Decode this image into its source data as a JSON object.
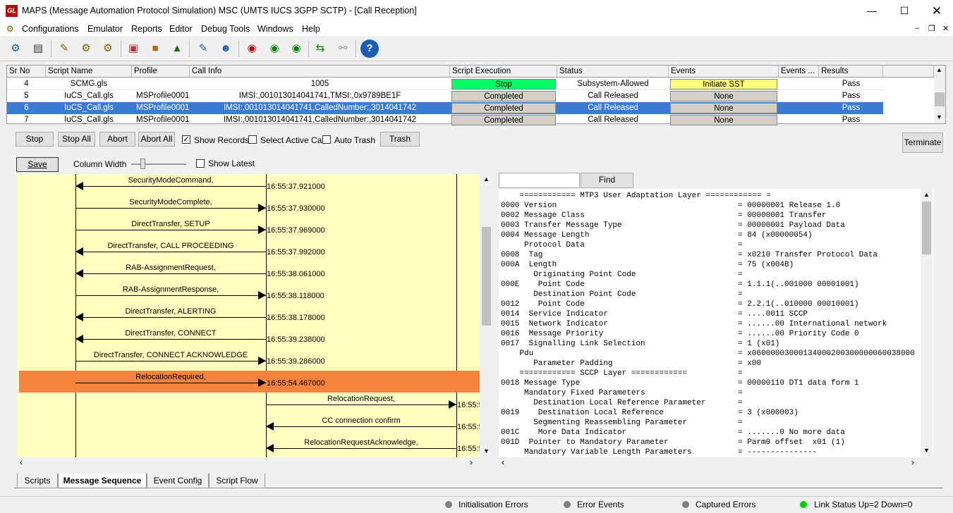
{
  "window": {
    "title": "MAPS (Message Automation Protocol Simulation) MSC (UMTS IUCS 3GPP SCTP) - [Call Reception]",
    "app_icon": "GL"
  },
  "menu": [
    "Configurations",
    "Emulator",
    "Reports",
    "Editor",
    "Debug Tools",
    "Windows",
    "Help"
  ],
  "grid": {
    "headers": [
      "Sr No",
      "Script Name",
      "Profile",
      "Call Info",
      "Script Execution",
      "Status",
      "Events",
      "Events ...",
      "Results"
    ],
    "rows": [
      {
        "sr": "4",
        "script": "SCMG.gls",
        "profile": "",
        "info": "1005",
        "exec": "Stop",
        "status": "Subsystem-Allowed",
        "events": "Initiate SST",
        "events2": "",
        "result": "Pass",
        "exec_color": "#00ff66",
        "events_color": "#ffff80",
        "selected": false
      },
      {
        "sr": "5",
        "script": "IuCS_Call.gls",
        "profile": "MSProfile0001",
        "info": "IMSI:,001013014041741,TMSI:,0x9789BE1F",
        "exec": "Completed",
        "status": "Call Released",
        "events": "None",
        "events2": "",
        "result": "Pass",
        "exec_color": "#d4d0c8",
        "events_color": "#d4d0c8",
        "selected": false
      },
      {
        "sr": "6",
        "script": "IuCS_Call.gls",
        "profile": "MSProfile0001",
        "info": "IMSI:,001013014041741,CalledNumber:,3014041742",
        "exec": "Completed",
        "status": "Call Released",
        "events": "None",
        "events2": "",
        "result": "Pass",
        "exec_color": "#d4d0c8",
        "events_color": "#d4d0c8",
        "selected": true
      },
      {
        "sr": "7",
        "script": "IuCS_Call.gls",
        "profile": "MSProfile0001",
        "info": "IMSI:,001013014041741,CalledNumber:,3014041742",
        "exec": "Completed",
        "status": "Call Released",
        "events": "None",
        "events2": "",
        "result": "Pass",
        "exec_color": "#d4d0c8",
        "events_color": "#d4d0c8",
        "selected": false
      }
    ]
  },
  "controls": {
    "stop": "Stop",
    "stop_all": "Stop All",
    "abort": "Abort",
    "abort_all": "Abort All",
    "show_records": "Show Records",
    "select_active": "Select Active Call",
    "auto_trash": "Auto Trash",
    "trash": "Trash",
    "terminate": "Terminate",
    "save": "Save",
    "column_width": "Column Width",
    "show_latest": "Show Latest",
    "find": "Find",
    "find_value": ""
  },
  "sequence": [
    {
      "label": "SecurityModeCommand,",
      "time": "16:55:37.921000",
      "dir": "left",
      "lane": 0,
      "highlight": false
    },
    {
      "label": "SecurityModeComplete,",
      "time": "16:55:37.930000",
      "dir": "right",
      "lane": 0,
      "highlight": false
    },
    {
      "label": "DirectTransfer, SETUP",
      "time": "16:55:37.969000",
      "dir": "right",
      "lane": 0,
      "highlight": false
    },
    {
      "label": "DirectTransfer, CALL PROCEEDING",
      "time": "16:55:37.992000",
      "dir": "left",
      "lane": 0,
      "highlight": false
    },
    {
      "label": "RAB-AssignmentRequest,",
      "time": "16:55:38.061000",
      "dir": "left",
      "lane": 0,
      "highlight": false
    },
    {
      "label": "RAB-AssignmentResponse,",
      "time": "16:55:38.118000",
      "dir": "right",
      "lane": 0,
      "highlight": false
    },
    {
      "label": "DirectTransfer, ALERTING",
      "time": "16:55:38.178000",
      "dir": "left",
      "lane": 0,
      "highlight": false
    },
    {
      "label": "DirectTransfer, CONNECT",
      "time": "16:55:39.238000",
      "dir": "left",
      "lane": 0,
      "highlight": false
    },
    {
      "label": "DirectTransfer, CONNECT ACKNOWLEDGE",
      "time": "16:55:39.286000",
      "dir": "right",
      "lane": 0,
      "highlight": false
    },
    {
      "label": "RelocationRequired,",
      "time": "16:55:54.467000",
      "dir": "right",
      "lane": 0,
      "highlight": true
    },
    {
      "label": "RelocationRequest,",
      "time": "16:55:5",
      "dir": "right",
      "lane": 1,
      "highlight": false
    },
    {
      "label": "CC connection confirm",
      "time": "16:55:5",
      "dir": "left",
      "lane": 1,
      "highlight": false
    },
    {
      "label": "RelocationRequestAcknowledge,",
      "time": "16:55:5",
      "dir": "left",
      "lane": 1,
      "highlight": false
    }
  ],
  "decode": [
    [
      "    ============ MTP3 User Adaptation Layer ============ =",
      ""
    ],
    [
      "0000 Version",
      "= 00000001 Release 1.0"
    ],
    [
      "0002 Message Class",
      "= 00000001 Transfer"
    ],
    [
      "0003 Transfer Message Type",
      "= 00000001 Payload Data"
    ],
    [
      "0004 Message Length",
      "= 84 (x00000054)"
    ],
    [
      "     Protocol Data",
      "="
    ],
    [
      "0008  Tag",
      "= x0210 Transfer Protocol Data"
    ],
    [
      "000A  Length",
      "= 75 (x004B)"
    ],
    [
      "       Originating Point Code",
      "="
    ],
    [
      "000E    Point Code",
      "= 1.1.1(..001000 00001001)"
    ],
    [
      "       Destination Point Code",
      "="
    ],
    [
      "0012    Point Code",
      "= 2.2.1(..010000 00010001)"
    ],
    [
      "0014  Service Indicator",
      "= ....0011 SCCP"
    ],
    [
      "0015  Network Indicator",
      "= ......00 International network"
    ],
    [
      "0016  Message Priority",
      "= ......00 Priority Code 0"
    ],
    [
      "0017  Signalling Link Selection",
      "= 1 (x01)"
    ],
    [
      "    Pdu",
      "= x06000003000134000200300000060038000"
    ],
    [
      "       Parameter Padding",
      "= x00"
    ],
    [
      "    ============ SCCP Layer ============",
      "="
    ],
    [
      "0018 Message Type",
      "= 00000110 DT1 data form 1"
    ],
    [
      "     Mandatory Fixed Parameters",
      "="
    ],
    [
      "       Destination Local Reference Parameter",
      "="
    ],
    [
      "0019    Destination Local Reference",
      "= 3 (x000003)"
    ],
    [
      "       Segmenting Reassembling Parameter",
      "="
    ],
    [
      "001C    More Data Indicator",
      "= .......0 No more data"
    ],
    [
      "001D  Pointer to Mandatory Parameter",
      "= Parm0 offset  x01 (1)"
    ],
    [
      "     Mandatory Variable Length Parameters",
      "= ---------------"
    ]
  ],
  "tabs": [
    "Scripts",
    "Message Sequence",
    "Event Config",
    "Script Flow"
  ],
  "status": {
    "init": "Initialisation Errors",
    "events": "Error Events",
    "captured": "Captured Errors",
    "link": "Link Status Up=2 Down=0",
    "link_color": "#00cc00",
    "dot_color": "#808080"
  }
}
